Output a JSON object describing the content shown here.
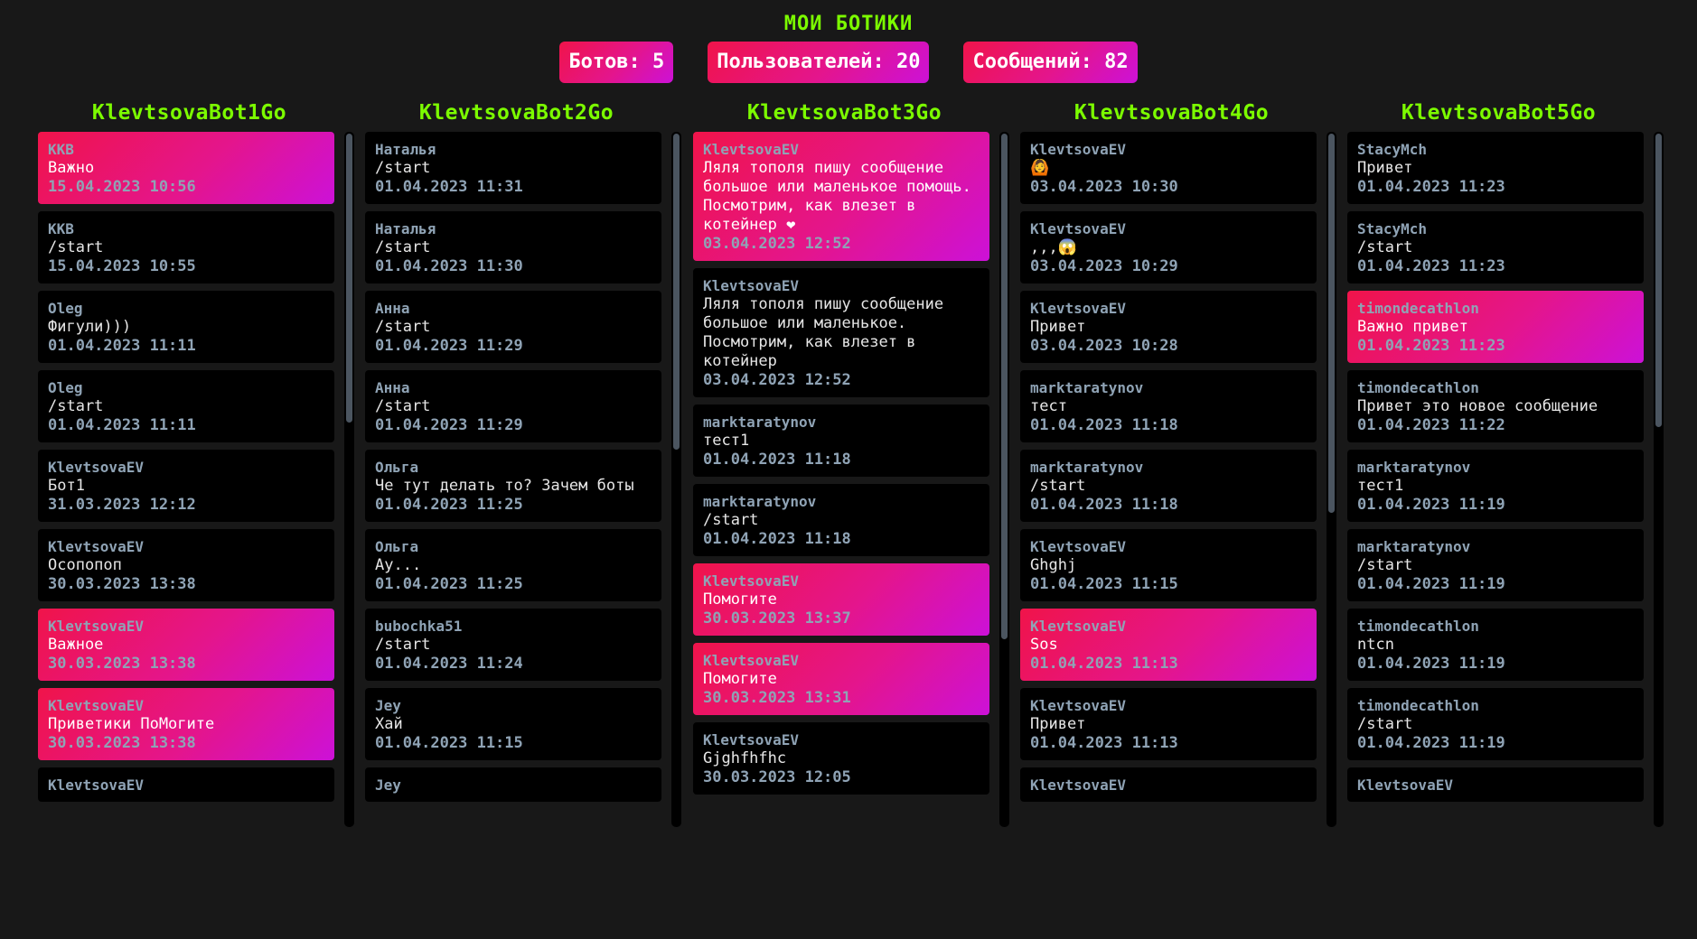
{
  "page": {
    "title": "МОИ БОТИКИ"
  },
  "stats": {
    "bots": "Ботов: 5",
    "users": "Пользователей: 20",
    "messages": "Сообщений: 82"
  },
  "colors": {
    "background": "#181818",
    "accent_green": "#7cfc00",
    "gradient_start": "#f0144a",
    "gradient_end": "#cc11d8",
    "card": "#000000",
    "meta_text": "#8fa3b5"
  },
  "columns": [
    {
      "title": "KlevtsovaBot1Go",
      "messages": [
        {
          "author": "KKB",
          "text": "Важно",
          "date": "15.04.2023 10:56",
          "important": true
        },
        {
          "author": "KKB",
          "text": "/start",
          "date": "15.04.2023 10:55",
          "important": false
        },
        {
          "author": "Oleg",
          "text": "Фигули)))",
          "date": "01.04.2023 11:11",
          "important": false
        },
        {
          "author": "Oleg",
          "text": "/start",
          "date": "01.04.2023 11:11",
          "important": false
        },
        {
          "author": "KlevtsovaEV",
          "text": "Бот1",
          "date": "31.03.2023 12:12",
          "important": false
        },
        {
          "author": "KlevtsovaEV",
          "text": "Осопопоп",
          "date": "30.03.2023 13:38",
          "important": false
        },
        {
          "author": "KlevtsovaEV",
          "text": "Важное",
          "date": "30.03.2023 13:38",
          "important": true
        },
        {
          "author": "KlevtsovaEV",
          "text": "Приветики ПоМогите",
          "date": "30.03.2023 13:38",
          "important": true
        },
        {
          "author": "KlevtsovaEV",
          "text": "",
          "date": "",
          "important": false
        }
      ]
    },
    {
      "title": "KlevtsovaBot2Go",
      "messages": [
        {
          "author": "Наталья",
          "text": "/start",
          "date": "01.04.2023 11:31",
          "important": false
        },
        {
          "author": "Наталья",
          "text": "/start",
          "date": "01.04.2023 11:30",
          "important": false
        },
        {
          "author": "Анна",
          "text": "/start",
          "date": "01.04.2023 11:29",
          "important": false
        },
        {
          "author": "Анна",
          "text": "/start",
          "date": "01.04.2023 11:29",
          "important": false
        },
        {
          "author": "Ольга",
          "text": "Че тут делать то? Зачем боты",
          "date": "01.04.2023 11:25",
          "important": false
        },
        {
          "author": "Ольга",
          "text": "Ау...",
          "date": "01.04.2023 11:25",
          "important": false
        },
        {
          "author": "bubochka51",
          "text": "/start",
          "date": "01.04.2023 11:24",
          "important": false
        },
        {
          "author": "Jey",
          "text": "Хай",
          "date": "01.04.2023 11:15",
          "important": false
        },
        {
          "author": "Jey",
          "text": "",
          "date": "",
          "important": false
        }
      ]
    },
    {
      "title": "KlevtsovaBot3Go",
      "messages": [
        {
          "author": "KlevtsovaEV",
          "text": "Ляля тополя пишу сообщение большое или маленькое помощь. Посмотрим, как влезет в котейнер ❤",
          "date": "03.04.2023 12:52",
          "important": true
        },
        {
          "author": "KlevtsovaEV",
          "text": "Ляля тополя пишу сообщение большое или маленькое. Посмотрим, как влезет в котейнер",
          "date": "03.04.2023 12:52",
          "important": false
        },
        {
          "author": "marktaratynov",
          "text": "тест1",
          "date": "01.04.2023 11:18",
          "important": false
        },
        {
          "author": "marktaratynov",
          "text": "/start",
          "date": "01.04.2023 11:18",
          "important": false
        },
        {
          "author": "KlevtsovaEV",
          "text": "Помогите",
          "date": "30.03.2023 13:37",
          "important": true
        },
        {
          "author": "KlevtsovaEV",
          "text": "Помогите",
          "date": "30.03.2023 13:31",
          "important": true
        },
        {
          "author": "KlevtsovaEV",
          "text": "Gjghfhfhc",
          "date": "30.03.2023 12:05",
          "important": false
        }
      ]
    },
    {
      "title": "KlevtsovaBot4Go",
      "messages": [
        {
          "author": "KlevtsovaEV",
          "text": "🙆",
          "date": "03.04.2023 10:30",
          "important": false
        },
        {
          "author": "KlevtsovaEV",
          "text": ",,,😱",
          "date": "03.04.2023 10:29",
          "important": false
        },
        {
          "author": "KlevtsovaEV",
          "text": "Привет",
          "date": "03.04.2023 10:28",
          "important": false
        },
        {
          "author": "marktaratynov",
          "text": "тест",
          "date": "01.04.2023 11:18",
          "important": false
        },
        {
          "author": "marktaratynov",
          "text": "/start",
          "date": "01.04.2023 11:18",
          "important": false
        },
        {
          "author": "KlevtsovaEV",
          "text": "Ghghj",
          "date": "01.04.2023 11:15",
          "important": false
        },
        {
          "author": "KlevtsovaEV",
          "text": "Sos",
          "date": "01.04.2023 11:13",
          "important": true
        },
        {
          "author": "KlevtsovaEV",
          "text": "Привет",
          "date": "01.04.2023 11:13",
          "important": false
        },
        {
          "author": "KlevtsovaEV",
          "text": "",
          "date": "",
          "important": false
        }
      ]
    },
    {
      "title": "KlevtsovaBot5Go",
      "messages": [
        {
          "author": "StacyMch",
          "text": "Привет",
          "date": "01.04.2023 11:23",
          "important": false
        },
        {
          "author": "StacyMch",
          "text": "/start",
          "date": "01.04.2023 11:23",
          "important": false
        },
        {
          "author": "timondecathlon",
          "text": "Важно привет",
          "date": "01.04.2023 11:23",
          "important": true
        },
        {
          "author": "timondecathlon",
          "text": "Привет это новое сообщение",
          "date": "01.04.2023 11:22",
          "important": false
        },
        {
          "author": "marktaratynov",
          "text": "тест1",
          "date": "01.04.2023 11:19",
          "important": false
        },
        {
          "author": "marktaratynov",
          "text": "/start",
          "date": "01.04.2023 11:19",
          "important": false
        },
        {
          "author": "timondecathlon",
          "text": "ntcn",
          "date": "01.04.2023 11:19",
          "important": false
        },
        {
          "author": "timondecathlon",
          "text": "/start",
          "date": "01.04.2023 11:19",
          "important": false
        },
        {
          "author": "KlevtsovaEV",
          "text": "",
          "date": "",
          "important": false
        }
      ]
    }
  ]
}
